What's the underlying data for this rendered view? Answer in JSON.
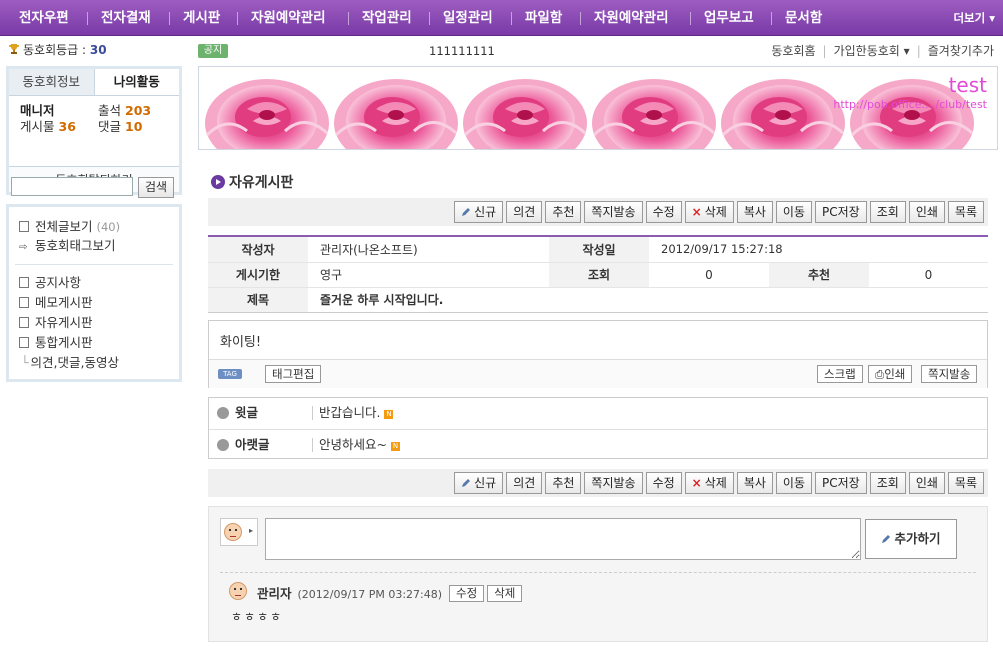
{
  "nav": {
    "items": [
      "전자우편",
      "전자결재",
      "게시판",
      "자원예약관리",
      "작업관리",
      "일정관리",
      "파일함",
      "자원예약관리",
      "업무보고",
      "문서함"
    ],
    "more": "더보기"
  },
  "sidebar": {
    "grade_label": "동호회등급 :",
    "grade_value": "30",
    "tabs": [
      "동호회정보",
      "나의활동"
    ],
    "manager_label": "매니저",
    "attendance_label": "출석",
    "attendance_value": "203",
    "posts_label": "게시물",
    "posts_value": "36",
    "comments_label": "댓글",
    "comments_value": "10",
    "leave_label": "동호회탈퇴하기",
    "search_placeholder": "",
    "search_button": "검색",
    "menu": {
      "all_posts": "전체글보기",
      "all_posts_count": "(40)",
      "tag_view": "동호회태그보기",
      "boards": [
        "공지사항",
        "메모게시판",
        "자유게시판",
        "통합게시판"
      ],
      "sub_item": "의견,댓글,동영상"
    }
  },
  "header": {
    "notice_badge": "공지",
    "notice_text": "111111111",
    "links": [
      "동호회홈",
      "가입한동호회",
      "즐겨찾기추가"
    ]
  },
  "banner": {
    "title": "test",
    "url": "http://pob.office..../club/test"
  },
  "board": {
    "title": "자유게시판",
    "toolbar": [
      "신규",
      "의견",
      "추천",
      "쪽지발송",
      "수정",
      "삭제",
      "복사",
      "이동",
      "PC저장",
      "조회",
      "인쇄",
      "목록"
    ]
  },
  "post": {
    "author_label": "작성자",
    "author": "관리자(나온소프트)",
    "date_label": "작성일",
    "date": "2012/09/17 15:27:18",
    "period_label": "게시기한",
    "period": "영구",
    "views_label": "조회",
    "views": "0",
    "recommend_label": "추천",
    "recommend": "0",
    "subject_label": "제목",
    "subject": "즐거운 하루 시작입니다.",
    "body": "화이팅!",
    "tag_badge": "TAG",
    "tag_edit": "태그편집",
    "scrap": "스크랩",
    "print": "인쇄",
    "send_note": "쪽지발송"
  },
  "navigation": {
    "prev_label": "윗글",
    "prev_text": "반갑습니다.",
    "next_label": "아랫글",
    "next_text": "안녕하세요~",
    "new_badge": "N"
  },
  "comments": {
    "add_button": "추가하기",
    "input_value": "",
    "items": [
      {
        "author": "관리자",
        "date": "(2012/09/17 PM 03:27:48)",
        "edit": "수정",
        "delete": "삭제",
        "text": "ㅎㅎㅎㅎ"
      }
    ]
  },
  "colors": {
    "nav_bg": "#8a4ab5",
    "accent": "#8b5ab1",
    "count_orange": "#d16a00",
    "banner_text": "#e24ad8"
  }
}
